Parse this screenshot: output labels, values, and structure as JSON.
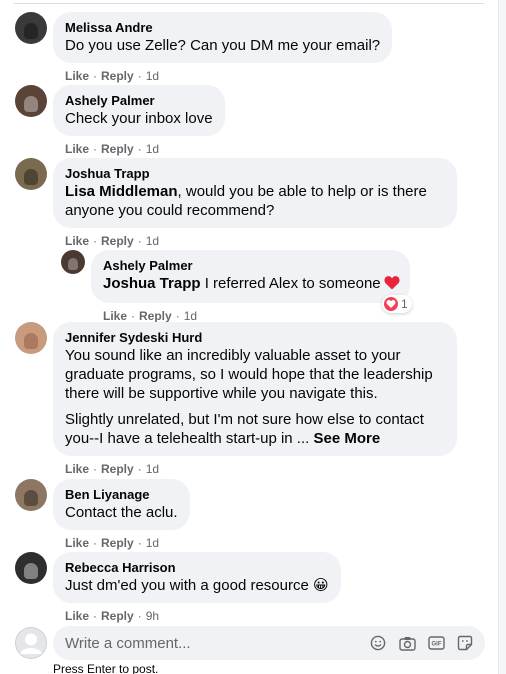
{
  "colors": {
    "bubble": "#f0f2f5",
    "secondary_text": "#65676b",
    "love_reaction": "#f33e58"
  },
  "actions": {
    "like": "Like",
    "reply": "Reply",
    "separator": "·"
  },
  "comments": [
    {
      "author": "Melissa Andre",
      "text": "Do you use Zelle? Can you DM me your email?",
      "time": "1d",
      "avatar_color": "#3a3a3a"
    },
    {
      "author": "Ashely Palmer",
      "text": "Check your inbox love",
      "time": "1d",
      "avatar_color": "#5a4438"
    },
    {
      "author": "Joshua Trapp",
      "mention": "Lisa Middleman",
      "text": ", would you be able to help or is there anyone you could recommend?",
      "time": "1d",
      "avatar_color": "#7a6a4f",
      "reply": {
        "author": "Ashely Palmer",
        "mention": "Joshua Trapp",
        "text": " I referred Alex to someone",
        "time": "1d",
        "reaction_icon": "love-reaction",
        "reaction_count": "1",
        "avatar_color": "#4a3a32"
      }
    },
    {
      "author": "Jennifer Sydeski Hurd",
      "text": "You sound like an incredibly valuable asset to your graduate programs, so I would hope that the leadership there will be supportive while you navigate this.",
      "text2": "Slightly unrelated, but I'm not sure how else to contact you--I have a telehealth start-up in ... ",
      "see_more": "See More",
      "time": "1d",
      "avatar_color": "#c89a7e"
    },
    {
      "author": "Ben Liyanage",
      "text": "Contact the aclu.",
      "time": "1d",
      "avatar_color": "#8d7763"
    },
    {
      "author": "Rebecca Harrison",
      "text": "Just dm'ed you with a good resource",
      "emoji": "😀",
      "time": "9h",
      "avatar_color": "#2e2e2e"
    }
  ],
  "composer": {
    "placeholder": "Write a comment...",
    "hint": "Press Enter to post.",
    "tools": [
      "emoji-icon",
      "camera-icon",
      "gif-icon",
      "sticker-icon"
    ]
  }
}
